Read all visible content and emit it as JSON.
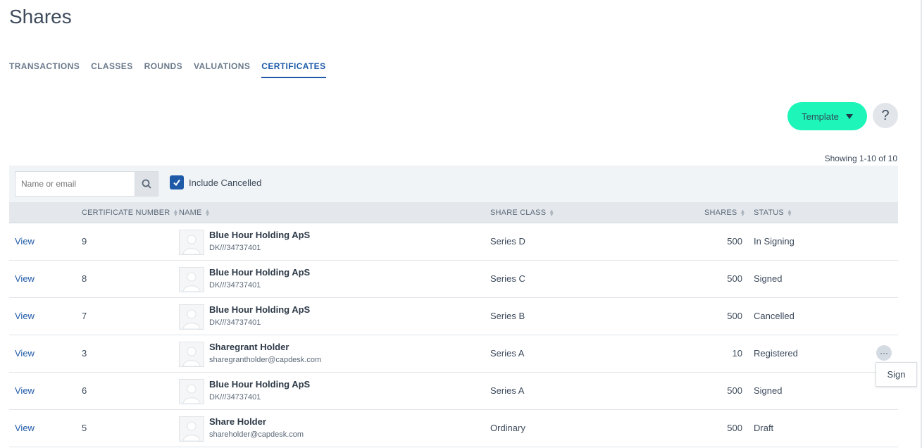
{
  "page": {
    "title": "Shares"
  },
  "tabs": [
    {
      "label": "TRANSACTIONS",
      "active": false
    },
    {
      "label": "CLASSES",
      "active": false
    },
    {
      "label": "ROUNDS",
      "active": false
    },
    {
      "label": "VALUATIONS",
      "active": false
    },
    {
      "label": "CERTIFICATES",
      "active": true
    }
  ],
  "toolbar": {
    "template_label": "Template",
    "help_label": "?"
  },
  "pagination": {
    "showing": "Showing 1-10 of 10"
  },
  "filters": {
    "search_placeholder": "Name or email",
    "include_cancelled_label": "Include Cancelled",
    "include_cancelled_checked": true
  },
  "columns": {
    "certificate_number": "CERTIFICATE NUMBER",
    "name": "NAME",
    "share_class": "SHARE CLASS",
    "shares": "SHARES",
    "status": "STATUS"
  },
  "rows": [
    {
      "action": "View",
      "number": "9",
      "name": "Blue Hour Holding ApS",
      "sub": "DK///34737401",
      "share_class": "Series D",
      "shares": "500",
      "status": "In Signing"
    },
    {
      "action": "View",
      "number": "8",
      "name": "Blue Hour Holding ApS",
      "sub": "DK///34737401",
      "share_class": "Series C",
      "shares": "500",
      "status": "Signed"
    },
    {
      "action": "View",
      "number": "7",
      "name": "Blue Hour Holding ApS",
      "sub": "DK///34737401",
      "share_class": "Series B",
      "shares": "500",
      "status": "Cancelled"
    },
    {
      "action": "View",
      "number": "3",
      "name": "Sharegrant Holder",
      "sub": "sharegrantholder@capdesk.com",
      "share_class": "Series A",
      "shares": "10",
      "status": "Registered"
    },
    {
      "action": "View",
      "number": "6",
      "name": "Blue Hour Holding ApS",
      "sub": "DK///34737401",
      "share_class": "Series A",
      "shares": "500",
      "status": "Signed"
    },
    {
      "action": "View",
      "number": "5",
      "name": "Share Holder",
      "sub": "shareholder@capdesk.com",
      "share_class": "Ordinary",
      "shares": "500",
      "status": "Draft"
    }
  ],
  "row_menu": {
    "button_label": "···",
    "items": [
      "Sign"
    ]
  },
  "colors": {
    "accent": "#1e5aa8",
    "template_button": "#1ef5b8"
  }
}
